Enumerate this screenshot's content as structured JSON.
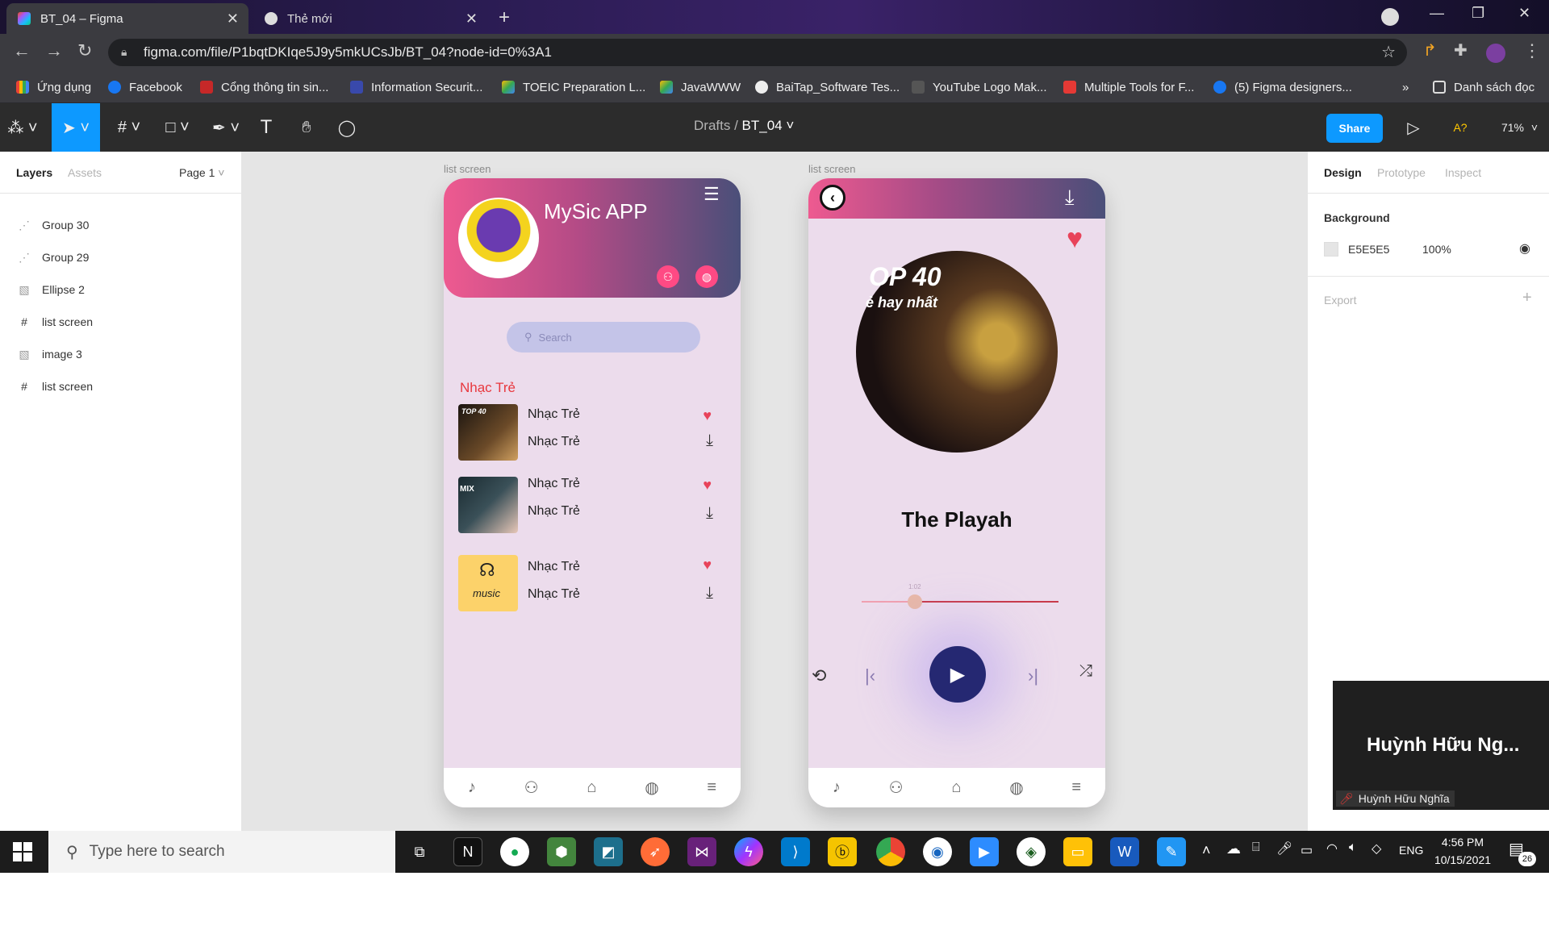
{
  "browser": {
    "tabs": [
      {
        "title": "BT_04 – Figma",
        "active": true
      },
      {
        "title": "Thẻ mới",
        "active": false
      }
    ],
    "url": "figma.com/file/P1bqtDKIqe5J9y5mkUCsJb/BT_04?node-id=0%3A1",
    "bookmarks": [
      "Ứng dụng",
      "Facebook",
      "Cổng thông tin sin...",
      "Information Securit...",
      "TOEIC Preparation L...",
      "JavaWWW",
      "BaiTap_Software Tes...",
      "YouTube Logo Mak...",
      "Multiple Tools for F...",
      "(5) Figma designers...",
      "Danh sách đọc"
    ]
  },
  "figma": {
    "breadcrumb_root": "Drafts",
    "breadcrumb_sep": "/",
    "file_name": "BT_04",
    "share_label": "Share",
    "zoom": "71%",
    "font_warning": "A?",
    "left_tabs": [
      "Layers",
      "Assets"
    ],
    "page_selector": "Page 1",
    "layers": [
      "Group 30",
      "Group 29",
      "Ellipse 2",
      "list screen",
      "image 3",
      "list screen"
    ],
    "right_tabs": [
      "Design",
      "Prototype",
      "Inspect"
    ],
    "background_label": "Background",
    "background_hex": "E5E5E5",
    "background_opacity": "100%",
    "export_label": "Export",
    "colors": {
      "accent": "#0d99ff",
      "canvas": "#e5e5e5"
    }
  },
  "frames": {
    "frame1_label": "list screen",
    "frame2_label": "list screen"
  },
  "phone1": {
    "app_title": "MySic APP",
    "search_placeholder": "Search",
    "section_title": "Nhạc Trẻ",
    "songs": [
      {
        "title": "Nhạc Trẻ",
        "subtitle": "Nhạc Trẻ",
        "thumb_text": "TOP 40"
      },
      {
        "title": "Nhạc Trẻ",
        "subtitle": "Nhạc Trẻ",
        "thumb_text": "MIX"
      },
      {
        "title": "Nhạc Trẻ",
        "subtitle": "Nhạc Trẻ",
        "thumb_text": "music"
      }
    ]
  },
  "phone2": {
    "cover_title": "OP 40",
    "cover_subtitle": "ẻ hay nhất",
    "song_title": "The Playah",
    "time": "1:02",
    "progress": 0.27
  },
  "zoom_tile": {
    "display_name": "Huỳnh Hữu Ng...",
    "full_name": "Huỳnh Hữu Nghĩa"
  },
  "taskbar": {
    "search_placeholder": "Type here to search",
    "language": "ENG",
    "time": "4:56 PM",
    "date": "10/15/2021",
    "notifications": "26"
  }
}
